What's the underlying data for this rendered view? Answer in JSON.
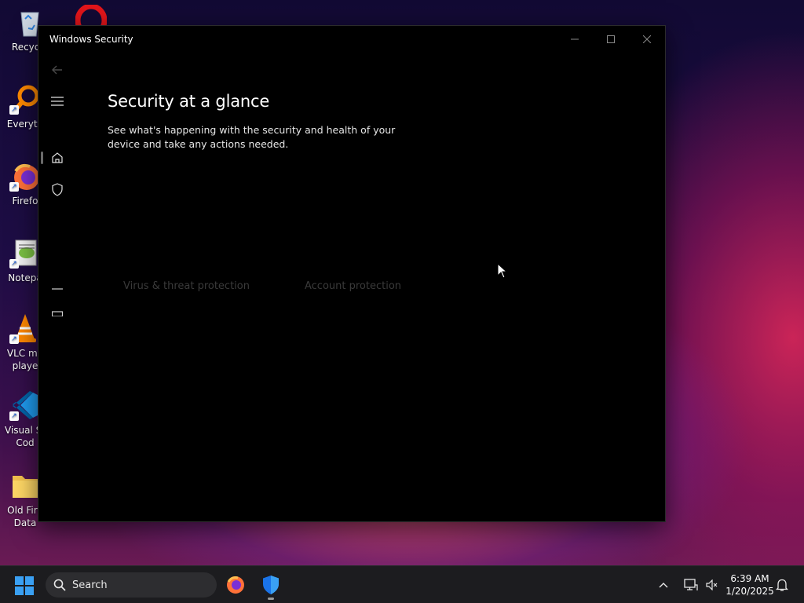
{
  "desktop": {
    "icons": [
      {
        "label": "Recycle",
        "icon": "recycle-bin-icon"
      },
      {
        "label": "Everyth",
        "icon": "everything-search-icon"
      },
      {
        "label": "Firefo",
        "icon": "firefox-icon"
      },
      {
        "label": "Notepa",
        "icon": "notepad-icon"
      },
      {
        "label": "VLC me",
        "label2": "playe",
        "icon": "vlc-icon"
      },
      {
        "label": "Visual St",
        "label2": "Cod",
        "icon": "vscode-icon"
      },
      {
        "label": "Old Fire",
        "label2": "Data",
        "icon": "folder-icon"
      },
      {
        "label": "",
        "icon": "opera-icon"
      }
    ]
  },
  "window": {
    "title": "Windows Security",
    "controls": {
      "minimize": "minimize-icon",
      "maximize": "maximize-icon",
      "close": "close-icon"
    }
  },
  "nav": {
    "back": "back-arrow-icon",
    "menu": "hamburger-menu-icon",
    "items": [
      "home-icon",
      "shield-icon"
    ]
  },
  "main": {
    "title": "Security at a glance",
    "subtitle": "See what's happening with the security and health of your device and take any actions needed.",
    "cards": [
      {
        "label": "Virus & threat protection"
      },
      {
        "label": "Account protection"
      }
    ]
  },
  "taskbar": {
    "search_label": "Search",
    "apps": [
      "firefox-icon",
      "windows-security-icon"
    ],
    "time": "6:39 AM",
    "date": "1/20/2025"
  },
  "colors": {
    "accent": "#0078d4",
    "window_bg": "#000000",
    "taskbar_bg": "#1c1c1f"
  }
}
